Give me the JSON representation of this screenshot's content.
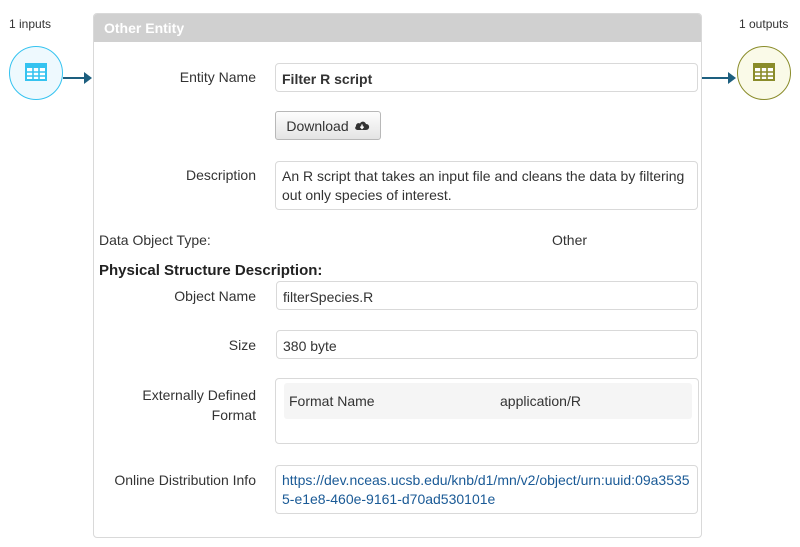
{
  "inputs": {
    "label": "1 inputs",
    "icon": "table-icon",
    "color": "#35c3f0"
  },
  "outputs": {
    "label": "1 outputs",
    "icon": "table-icon",
    "color": "#8a8c2a"
  },
  "panel": {
    "title": "Other Entity",
    "entity_name_label": "Entity Name",
    "entity_name": "Filter R script",
    "download_label": "Download",
    "download_icon": "cloud-download-icon",
    "description_label": "Description",
    "description": "An R script that takes an input file and cleans the data by filtering out only species of interest.",
    "data_object_type_label": "Data Object Type:",
    "data_object_type": "Other",
    "physical_title": "Physical Structure Description:",
    "object_name_label": "Object Name",
    "object_name": "filterSpecies.R",
    "size_label": "Size",
    "size": "380 byte",
    "format_label": "Externally Defined Format",
    "format_name_label": "Format Name",
    "format_name": "application/R",
    "online_label": "Online Distribution Info",
    "online_url": "https://dev.nceas.ucsb.edu/knb/d1/mn/v2/object/urn:uuid:09a35355-e1e8-460e-9161-d70ad530101e"
  }
}
